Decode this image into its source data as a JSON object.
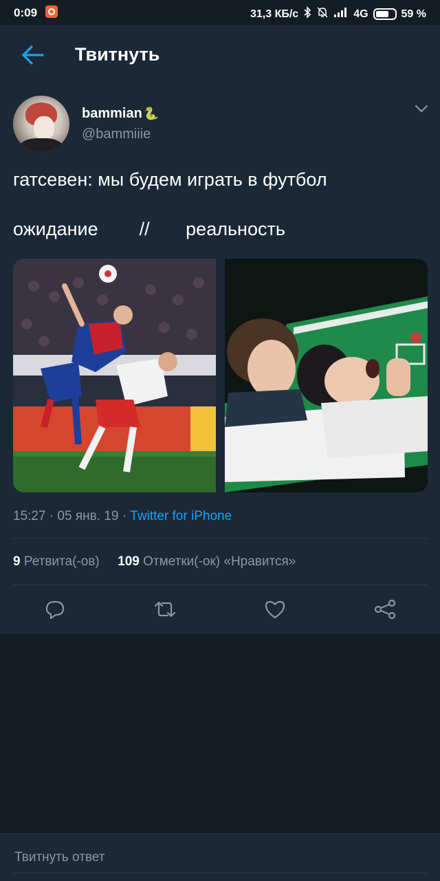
{
  "status_bar": {
    "time": "0:09",
    "network_speed": "31,3 КБ/с",
    "network_type": "4G",
    "battery": "59 %"
  },
  "header": {
    "title": "Твитнуть"
  },
  "tweet": {
    "display_name": "bammian",
    "handle": "@bammiiie",
    "text_line1": "гатсевен: мы будем играть в футбол",
    "text_line2": "ожидание        //       реальность",
    "timestamp": "15:27 · 05 янв. 19 · ",
    "source": "Twitter for iPhone",
    "retweets_count": "9",
    "retweets_label": " Ретвита(-ов)",
    "likes_count": "109",
    "likes_label": " Отметки(-ок) «Нравится»"
  },
  "reply": {
    "placeholder": "Твитнуть ответ"
  },
  "colors": {
    "background": "#141d26",
    "card": "#1b2836",
    "accent": "#1da1f2",
    "muted": "#8899a6"
  }
}
